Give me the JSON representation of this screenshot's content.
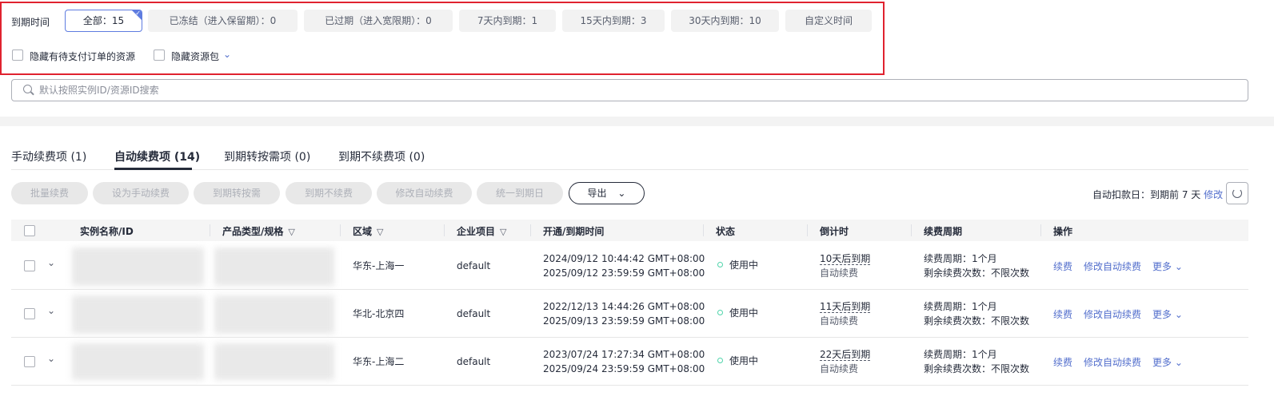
{
  "filters": {
    "label": "到期时间",
    "chips": [
      {
        "label": "全部：15",
        "active": true
      },
      {
        "label": "已冻结（进入保留期）：0"
      },
      {
        "label": "已过期（进入宽限期）：0"
      },
      {
        "label": "7天内到期：1"
      },
      {
        "label": "15天内到期：3"
      },
      {
        "label": "30天内到期：10"
      },
      {
        "label": "自定义时间"
      }
    ],
    "hide_pending_orders": "隐藏有待支付订单的资源",
    "hide_packages": "隐藏资源包"
  },
  "search": {
    "placeholder": "默认按照实例ID/资源ID搜索",
    "value": ""
  },
  "tabs": [
    {
      "label": "手动续费项 (1)"
    },
    {
      "label": "自动续费项 (14)",
      "active": true
    },
    {
      "label": "到期转按需项 (0)"
    },
    {
      "label": "到期不续费项 (0)"
    }
  ],
  "toolbar": {
    "buttons": [
      "批量续费",
      "设为手动续费",
      "到期转按需",
      "到期不续费",
      "修改自动续费",
      "统一到期日"
    ],
    "export": "导出",
    "auto_deduct_label": "自动扣款日：到期前 7 天",
    "modify": "修改"
  },
  "table": {
    "headers": [
      "实例名称/ID",
      "产品类型/规格",
      "区域",
      "企业项目",
      "开通/到期时间",
      "状态",
      "倒计时",
      "续费周期",
      "操作"
    ],
    "rows": [
      {
        "region": "华东-上海一",
        "project": "default",
        "opened": "2024/09/12 10:44:42 GMT+08:00",
        "expires": "2025/09/12 23:59:59 GMT+08:00",
        "status": "使用中",
        "countdown": "10天后到期",
        "renew_mode": "自动续费",
        "cycle": "续费周期：1个月",
        "remaining": "剩余续费次数：不限次数"
      },
      {
        "region": "华北-北京四",
        "project": "default",
        "opened": "2022/12/13 14:44:26 GMT+08:00",
        "expires": "2025/09/13 23:59:59 GMT+08:00",
        "status": "使用中",
        "countdown": "11天后到期",
        "renew_mode": "自动续费",
        "cycle": "续费周期：1个月",
        "remaining": "剩余续费次数：不限次数"
      },
      {
        "region": "华东-上海二",
        "project": "default",
        "opened": "2023/07/24 17:27:34 GMT+08:00",
        "expires": "2025/09/24 23:59:59 GMT+08:00",
        "status": "使用中",
        "countdown": "22天后到期",
        "renew_mode": "自动续费",
        "cycle": "续费周期：1个月",
        "remaining": "剩余续费次数：不限次数"
      }
    ],
    "row_actions": {
      "renew": "续费",
      "modify_auto": "修改自动续费",
      "more": "更多"
    }
  },
  "colors": {
    "accent": "#526ecc",
    "highlight": "#e0222f",
    "status_ok": "#50d4ab"
  }
}
